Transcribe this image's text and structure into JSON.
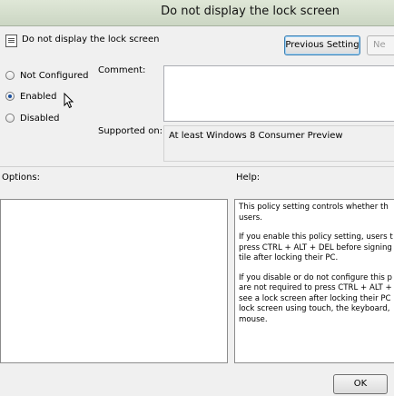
{
  "window": {
    "title": "Do not display the lock screen"
  },
  "header": {
    "policy_title": "Do not display the lock screen"
  },
  "toolbar": {
    "previous_label": "Previous Setting",
    "next_label": "Ne"
  },
  "radios": [
    {
      "label": "Not Configured",
      "checked": false
    },
    {
      "label": "Enabled",
      "checked": true
    },
    {
      "label": "Disabled",
      "checked": false
    }
  ],
  "comment": {
    "label": "Comment:",
    "value": ""
  },
  "supported": {
    "label": "Supported on:",
    "value": "At least Windows 8 Consumer Preview"
  },
  "options": {
    "label": "Options:"
  },
  "help": {
    "label": "Help:",
    "paragraphs": [
      [
        "This policy setting controls whether th",
        "users."
      ],
      [
        "If you enable this policy setting, users t",
        "press CTRL + ALT + DEL before signing",
        "tile after  locking their PC."
      ],
      [
        "If you disable or do not configure this p",
        "are not required to press CTRL + ALT +",
        "see a lock screen after locking their PC",
        "lock screen using touch, the keyboard,",
        "mouse."
      ]
    ]
  },
  "footer": {
    "ok_label": "OK"
  }
}
